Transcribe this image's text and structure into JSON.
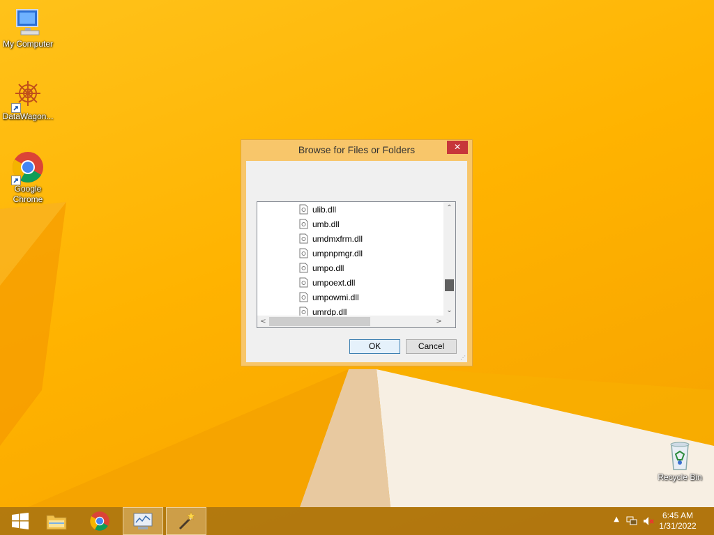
{
  "desktop": {
    "icons": [
      {
        "label": "My Computer"
      },
      {
        "label": "DataWagon..."
      },
      {
        "label": "Google Chrome"
      },
      {
        "label": "Recycle Bin"
      }
    ]
  },
  "dialog": {
    "title": "Browse for Files or Folders",
    "close_label": "✕",
    "files": [
      "ulib.dll",
      "umb.dll",
      "umdmxfrm.dll",
      "umpnpmgr.dll",
      "umpo.dll",
      "umpoext.dll",
      "umpowmi.dll",
      "umrdp.dll"
    ],
    "ok_label": "OK",
    "cancel_label": "Cancel",
    "scroll_up": "⌃",
    "scroll_down": "⌄",
    "scroll_left": "<",
    "scroll_right": ">"
  },
  "taskbar": {
    "time": "6:45 AM",
    "date": "1/31/2022"
  }
}
